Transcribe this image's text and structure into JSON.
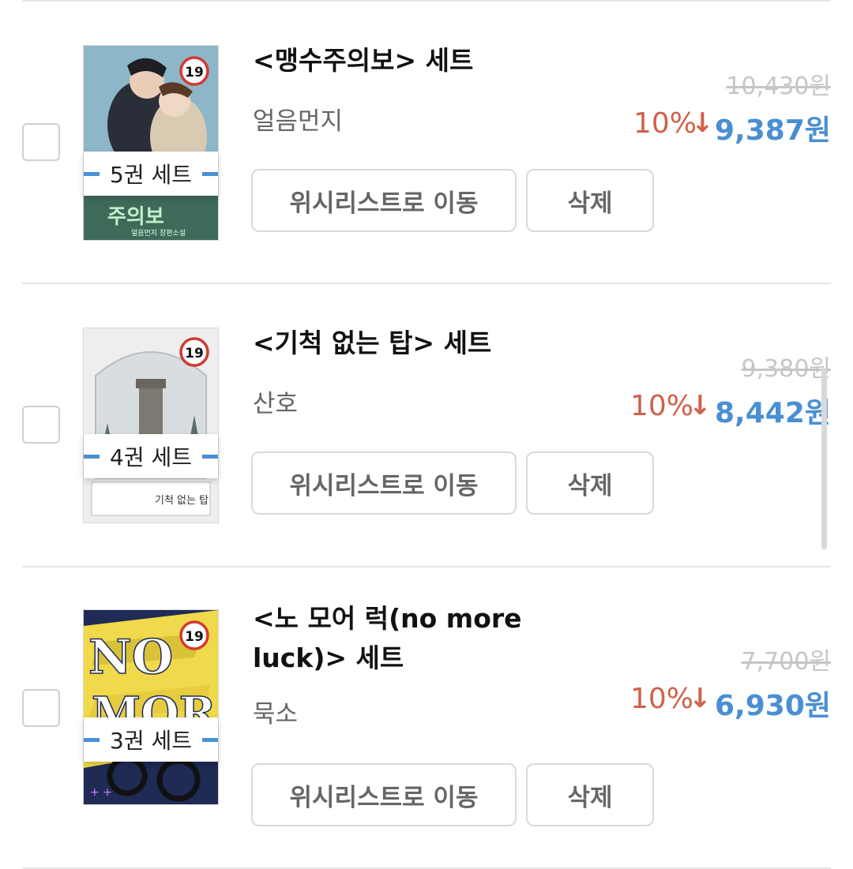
{
  "colors": {
    "accent_blue": "#4a8fd3",
    "discount_red": "#d0614a",
    "strike_gray": "#c6c6c6"
  },
  "items": [
    {
      "title": "<맹수주의보> 세트",
      "author": "얼음먼지",
      "set_count": "5권 세트",
      "original_price": "10,430원",
      "discount_rate": "10%",
      "discount_arrow": "↓",
      "final_price": "9,387원",
      "wishlist_button": "위시리스트로 이동",
      "delete_button": "삭제",
      "rating_badge": "19"
    },
    {
      "title": "<기척 없는 탑> 세트",
      "author": "산호",
      "set_count": "4권 세트",
      "original_price": "9,380원",
      "discount_rate": "10%",
      "discount_arrow": "↓",
      "final_price": "8,442원",
      "wishlist_button": "위시리스트로 이동",
      "delete_button": "삭제",
      "rating_badge": "19"
    },
    {
      "title": "<노 모어 럭(no more luck)> 세트",
      "author": "묵소",
      "set_count": "3권 세트",
      "original_price": "7,700원",
      "discount_rate": "10%",
      "discount_arrow": "↓",
      "final_price": "6,930원",
      "wishlist_button": "위시리스트로 이동",
      "delete_button": "삭제",
      "rating_badge": "19"
    }
  ]
}
